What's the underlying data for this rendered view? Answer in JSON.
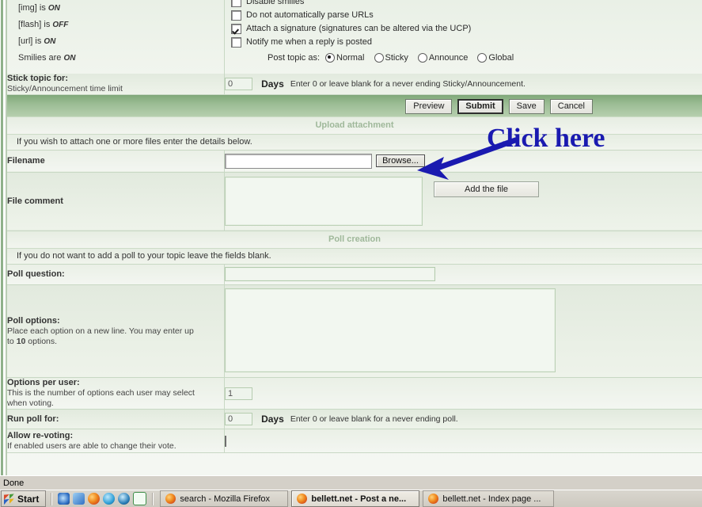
{
  "bbcode_info": {
    "lines": [
      {
        "tag": "[img] is ",
        "state": "ON"
      },
      {
        "tag": "[flash] is ",
        "state": "OFF"
      },
      {
        "tag": "[url] is ",
        "state": "ON"
      },
      {
        "tag": "Smilies are ",
        "state": "ON"
      }
    ]
  },
  "post_options": {
    "checkboxes": [
      {
        "label": "Disable smilies",
        "checked": false
      },
      {
        "label": "Do not automatically parse URLs",
        "checked": false
      },
      {
        "label": "Attach a signature (signatures can be altered via the UCP)",
        "checked": true
      },
      {
        "label": "Notify me when a reply is posted",
        "checked": false
      }
    ],
    "post_topic_as_label": "Post topic as:",
    "radios": [
      {
        "label": "Normal",
        "selected": true
      },
      {
        "label": "Sticky",
        "selected": false
      },
      {
        "label": "Announce",
        "selected": false
      },
      {
        "label": "Global",
        "selected": false
      }
    ]
  },
  "stick_topic": {
    "label": "Stick topic for:",
    "sublabel": "Sticky/Announcement time limit",
    "value": "0",
    "days": "Days",
    "hint": "Enter 0 or leave blank for a never ending Sticky/Announcement."
  },
  "buttons": {
    "preview": "Preview",
    "submit": "Submit",
    "save": "Save",
    "cancel": "Cancel"
  },
  "upload": {
    "header": "Upload attachment",
    "note": "If you wish to attach one or more files enter the details below.",
    "filename_label": "Filename",
    "filename_value": "",
    "browse_label": "Browse...",
    "file_comment_label": "File comment",
    "file_comment_value": "",
    "add_file_label": "Add the file"
  },
  "annotation": {
    "text": "Click here",
    "color": "#1a1ab0"
  },
  "poll": {
    "header": "Poll creation",
    "note": "If you do not want to add a poll to your topic leave the fields blank.",
    "question_label": "Poll question:",
    "question_value": "",
    "options_label": "Poll options:",
    "options_sub_1": "Place each option on a new line. You may enter up",
    "options_sub_2_pre": "to ",
    "options_sub_2_bold": "10",
    "options_sub_2_post": " options.",
    "options_value": "",
    "per_user_label": "Options per user:",
    "per_user_sub_1": "This is the number of options each user may select",
    "per_user_sub_2": "when voting.",
    "per_user_value": "1",
    "run_poll_label": "Run poll for:",
    "run_poll_value": "0",
    "run_poll_days": "Days",
    "run_poll_hint": "Enter 0 or leave blank for a never ending poll.",
    "revote_label": "Allow re-voting:",
    "revote_sub": "If enabled users are able to change their vote.",
    "revote_checked": false
  },
  "browser": {
    "status_text": "Done"
  },
  "taskbar": {
    "start_label": "Start",
    "quick_launch": [
      {
        "name": "internet-explorer-icon",
        "color": "#2f6fc4"
      },
      {
        "name": "show-desktop-icon",
        "color": "#3a7ec0"
      },
      {
        "name": "firefox-icon",
        "color": "#e8771d"
      },
      {
        "name": "media-player-icon",
        "color": "#2fa0d8"
      },
      {
        "name": "quicktime-icon",
        "color": "#2a7fb8"
      },
      {
        "name": "excel-icon",
        "color": "#3f8f4a"
      }
    ],
    "windows": [
      {
        "title": "search - Mozilla Firefox",
        "active": false
      },
      {
        "title": "bellett.net - Post a ne...",
        "active": true
      },
      {
        "title": "bellett.net - Index page ...",
        "active": false
      }
    ]
  }
}
